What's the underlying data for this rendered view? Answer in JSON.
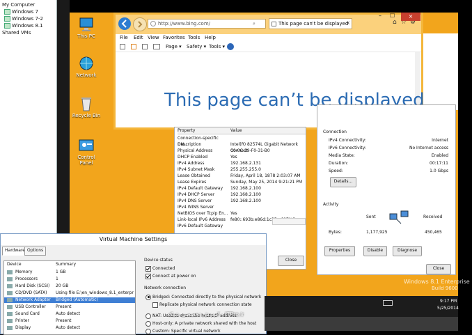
{
  "host_library": {
    "items": [
      "My Computer",
      "Windows 7",
      "Windows 7-2",
      "Windows 8.1",
      "Shared VMs"
    ]
  },
  "desktop": {
    "icons": [
      "This PC",
      "Network",
      "Recycle Bin",
      "Control Panel"
    ],
    "watermark_edition": "Windows 8.1 Enterprise",
    "watermark_build": "Build 9600"
  },
  "ie": {
    "address": "http://www.bing.com/",
    "tab_title": "This page can't be displayed",
    "menu": [
      "File",
      "Edit",
      "View",
      "Favorites",
      "Tools",
      "Help"
    ],
    "commands": [
      "Page ▾",
      "Safety ▾",
      "Tools ▾"
    ],
    "headline": "This page can’t be displayed"
  },
  "net_details": {
    "header": [
      "Property",
      "Value"
    ],
    "rows": [
      [
        "Connection-specific DN...",
        ""
      ],
      [
        "Description",
        "Intel(R) 82574L Gigabit Network Connect"
      ],
      [
        "Physical Address",
        "00-0C-29-F0-31-B0"
      ],
      [
        "DHCP Enabled",
        "Yes"
      ],
      [
        "IPv4 Address",
        "192.168.2.131"
      ],
      [
        "IPv4 Subnet Mask",
        "255.255.255.0"
      ],
      [
        "Lease Obtained",
        "Friday, April 18, 1878 2:03:07 AM"
      ],
      [
        "Lease Expires",
        "Sunday, May 25, 2014 9:21:21 PM"
      ],
      [
        "IPv4 Default Gateway",
        "192.168.2.100"
      ],
      [
        "IPv4 DHCP Server",
        "192.168.2.100"
      ],
      [
        "IPv4 DNS Server",
        "192.168.2.100"
      ],
      [
        "IPv4 WINS Server",
        ""
      ],
      [
        "NetBIOS over Tcpip En...",
        "Yes"
      ],
      [
        "Link-local IPv6 Address",
        "fe80::693b:e86d:1c35:a697%3"
      ],
      [
        "IPv6 Default Gateway",
        ""
      ]
    ],
    "close": "Close"
  },
  "net_status": {
    "connection_label": "Connection",
    "rows": [
      [
        "IPv4 Connectivity:",
        "Internet"
      ],
      [
        "IPv6 Connectivity:",
        "No Internet access"
      ],
      [
        "Media State:",
        "Enabled"
      ],
      [
        "Duration:",
        "00:17:11"
      ],
      [
        "Speed:",
        "1.0 Gbps"
      ]
    ],
    "details_btn": "Details...",
    "activity_label": "Activity",
    "sent": "Sent",
    "received": "Received",
    "bytes_label": "Bytes:",
    "bytes_sent": "1,177,925",
    "bytes_received": "450,465",
    "buttons": [
      "Properties",
      "Disable",
      "Diagnose"
    ],
    "close": "Close"
  },
  "vm_settings": {
    "title": "Virtual Machine Settings",
    "tabs": [
      "Hardware",
      "Options"
    ],
    "list_header": [
      "Device",
      "Summary"
    ],
    "devices": [
      [
        "Memory",
        "1 GB"
      ],
      [
        "Processors",
        "1"
      ],
      [
        "Hard Disk (SCSI)",
        "20 GB"
      ],
      [
        "CD/DVD (SATA)",
        "Using file E:\\en_windows_8.1_enterpri..."
      ],
      [
        "Network Adapter",
        "Bridged (Automatic)"
      ],
      [
        "USB Controller",
        "Present"
      ],
      [
        "Sound Card",
        "Auto detect"
      ],
      [
        "Printer",
        "Present"
      ],
      [
        "Display",
        "Auto detect"
      ]
    ],
    "device_status_label": "Device status",
    "connected": "Connected",
    "connect_at_power_on": "Connect at power on",
    "network_connection_label": "Network connection",
    "bridged": "Bridged: Connected directly to the physical network",
    "replicate": "Replicate physical network connection state",
    "nat": "NAT: Used to share the host's IP address",
    "host_only": "Host-only: A private network shared with the host",
    "custom": "Custom: Specific virtual network"
  },
  "taskbar": {
    "time": "9:17 PM",
    "date": "5/25/2014"
  },
  "overlay": {
    "watermark": "آموزش تخصصی شبکه - ITPro.ir"
  }
}
